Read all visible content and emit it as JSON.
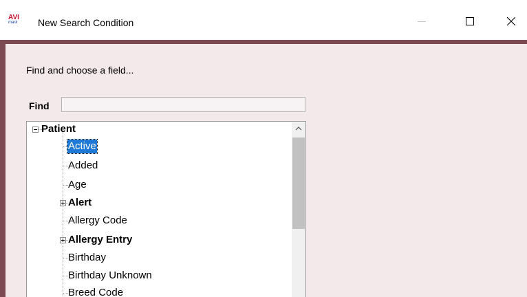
{
  "window": {
    "app_logo_text": "AVI",
    "app_logo_subtext": "mark",
    "title": "New Search Condition",
    "controls": [
      "minimize-icon",
      "maximize-icon",
      "close-icon"
    ]
  },
  "dialog": {
    "prompt": "Find and choose a field...",
    "find_label": "Find",
    "find_value": ""
  },
  "tree": {
    "root": {
      "label": "Patient",
      "bold": true,
      "expanded": true
    },
    "items": [
      {
        "label": "Active",
        "bold": false,
        "expandable": false,
        "selected": true
      },
      {
        "label": "Added",
        "bold": false,
        "expandable": false
      },
      {
        "label": "Age",
        "bold": false,
        "expandable": false
      },
      {
        "label": "Alert",
        "bold": true,
        "expandable": true
      },
      {
        "label": "Allergy Code",
        "bold": false,
        "expandable": false
      },
      {
        "label": "Allergy Entry",
        "bold": true,
        "expandable": true
      },
      {
        "label": "Birthday",
        "bold": false,
        "expandable": false
      },
      {
        "label": "Birthday Unknown",
        "bold": false,
        "expandable": false
      },
      {
        "label": "Breed Code",
        "bold": false,
        "expandable": false
      }
    ]
  },
  "colors": {
    "border": "#7b4a52",
    "client_bg": "#f3e9ea",
    "selection": "#1e7ad6",
    "logo_red": "#c8102e",
    "logo_blue": "#1a3a9a"
  }
}
